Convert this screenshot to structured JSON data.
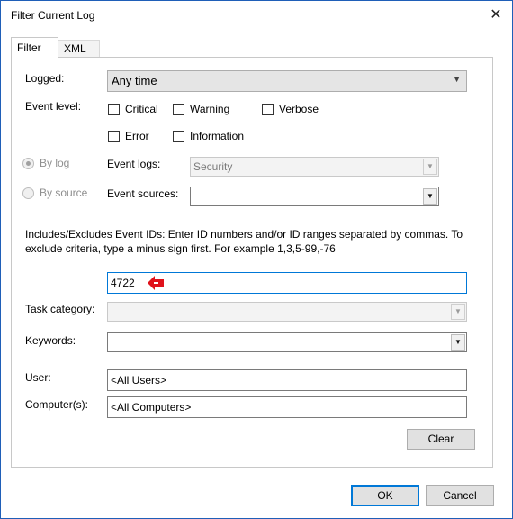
{
  "window": {
    "title": "Filter Current Log"
  },
  "tabs": [
    {
      "label": "Filter"
    },
    {
      "label": "XML"
    }
  ],
  "filter": {
    "logged": {
      "label": "Logged:",
      "value": "Any time"
    },
    "event_level": {
      "label": "Event level:",
      "options": [
        "Critical",
        "Warning",
        "Verbose",
        "Error",
        "Information"
      ]
    },
    "by_log": {
      "label": "By log"
    },
    "by_source": {
      "label": "By source"
    },
    "event_logs": {
      "label": "Event logs:",
      "value": "Security"
    },
    "event_sources": {
      "label": "Event sources:",
      "value": ""
    },
    "event_ids_description": "Includes/Excludes Event IDs: Enter ID numbers and/or ID ranges separated by commas. To exclude criteria, type a minus sign first. For example 1,3,5-99,-76",
    "event_ids": {
      "value": "4722"
    },
    "task_category": {
      "label": "Task category:",
      "value": ""
    },
    "keywords": {
      "label": "Keywords:",
      "value": ""
    },
    "user": {
      "label": "User:",
      "value": "<All Users>"
    },
    "computer": {
      "label": "Computer(s):",
      "value": "<All Computers>"
    },
    "clear_label": "Clear"
  },
  "footer": {
    "ok_label": "OK",
    "cancel_label": "Cancel"
  },
  "colors": {
    "accent": "#0078d7",
    "marker": "#e0121b"
  }
}
